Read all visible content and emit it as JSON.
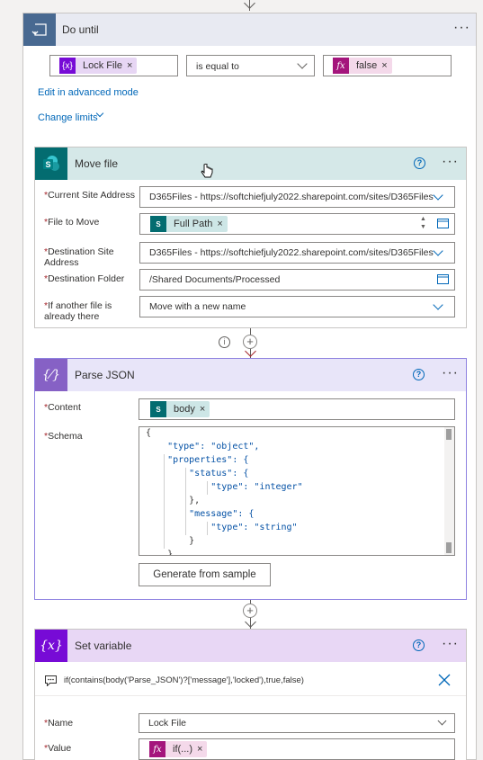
{
  "do_until": {
    "title": "Do until",
    "menu": "···",
    "condition": {
      "left_token": "Lock File",
      "operator": "is equal to",
      "right_token": "false"
    },
    "advanced_link": "Edit in advanced mode",
    "change_limits": "Change limits"
  },
  "move_file": {
    "title": "Move file",
    "menu": "···",
    "help": "?",
    "fields": [
      {
        "label": "Current Site Address",
        "value": "D365Files - https://softchiefjuly2022.sharepoint.com/sites/D365Files"
      },
      {
        "label": "File to Move",
        "token": "Full Path"
      },
      {
        "label": "Destination Site Address",
        "value": "D365Files - https://softchiefjuly2022.sharepoint.com/sites/D365Files"
      },
      {
        "label": "Destination Folder",
        "value": "/Shared Documents/Processed"
      },
      {
        "label": "If another file is already there",
        "value": "Move with a new name"
      }
    ],
    "required_mark": "*"
  },
  "parse_json": {
    "title": "Parse JSON",
    "menu": "···",
    "help": "?",
    "content_label": "Content",
    "content_token": "body",
    "schema_label": "Schema",
    "schema_lines": [
      "{",
      "    \"type\": \"object\",",
      "    \"properties\": {",
      "        \"status\": {",
      "            \"type\": \"integer\"",
      "        },",
      "        \"message\": {",
      "            \"type\": \"string\"",
      "        }",
      "    }"
    ],
    "generate_button": "Generate from sample"
  },
  "set_variable": {
    "title": "Set variable",
    "menu": "···",
    "help": "?",
    "expression": "if(contains(body('Parse_JSON')?['message'],'locked'),true,false)",
    "name_label": "Name",
    "name_value": "Lock File",
    "value_label": "Value",
    "value_token": "if(...)"
  },
  "colors": {
    "do_until_header": "#e8eaf2",
    "do_until_icon": "#486991",
    "sharepoint": "#036c70",
    "expression": "#a4157c",
    "variable": "#770bd6",
    "link": "#0067b8"
  }
}
